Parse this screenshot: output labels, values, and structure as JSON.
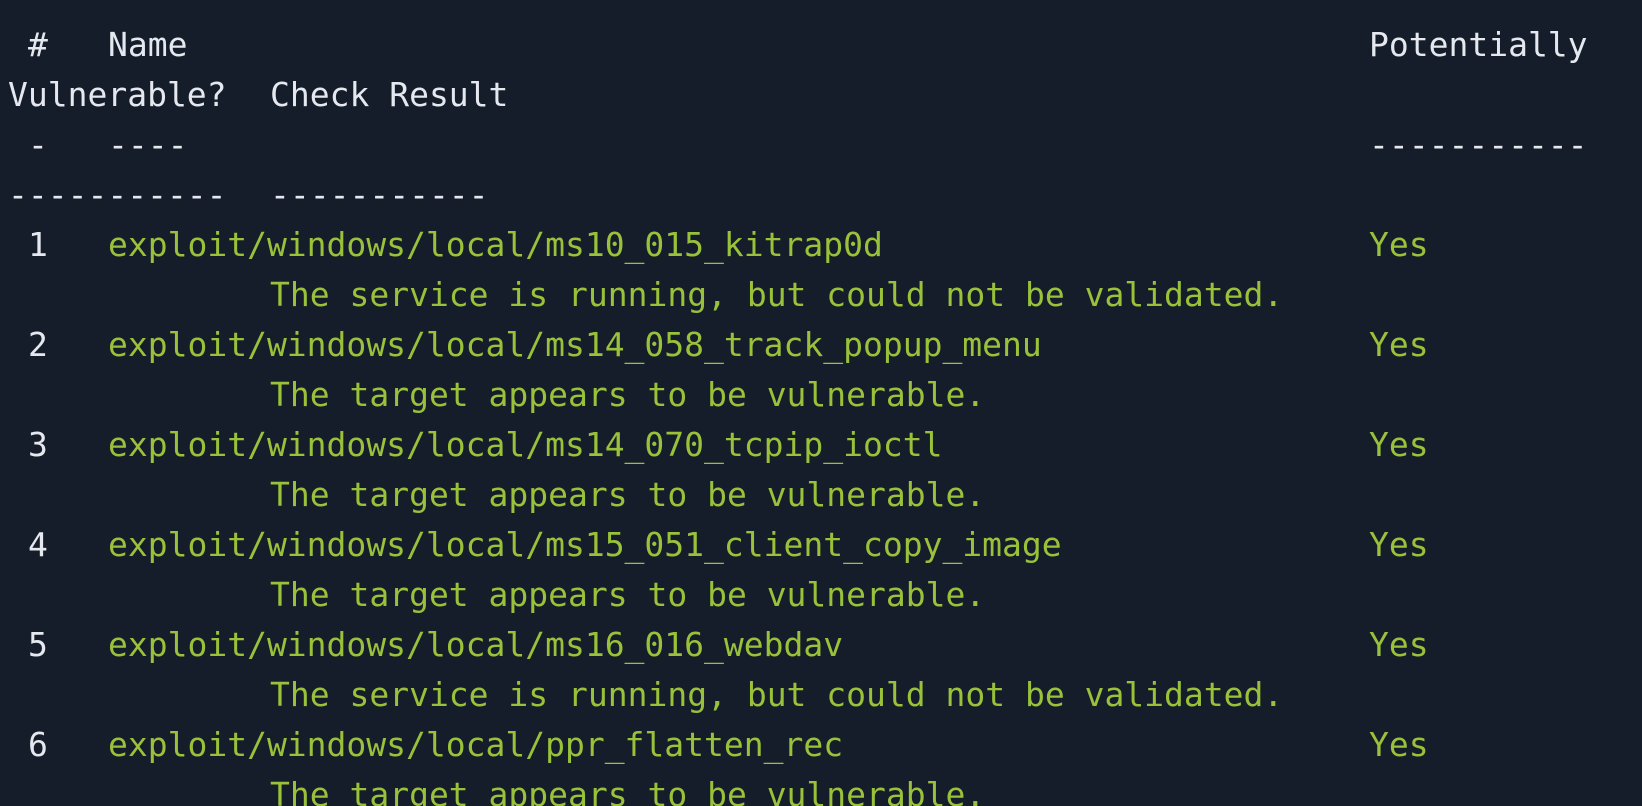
{
  "header": {
    "col_num": "#",
    "col_name": "Name",
    "col_potentially": "Potentially",
    "col_vulnerable": "Vulnerable?",
    "col_check": "Check Result"
  },
  "separator": {
    "num": "-",
    "name": "----",
    "potentially": "-----------",
    "vulnerable": "-----------",
    "check": "-----------"
  },
  "rows": [
    {
      "num": "1",
      "name": "exploit/windows/local/ms10_015_kitrap0d",
      "vulnerable": "Yes",
      "result": "The service is running, but could not be validated."
    },
    {
      "num": "2",
      "name": "exploit/windows/local/ms14_058_track_popup_menu",
      "vulnerable": "Yes",
      "result": "The target appears to be vulnerable."
    },
    {
      "num": "3",
      "name": "exploit/windows/local/ms14_070_tcpip_ioctl",
      "vulnerable": "Yes",
      "result": "The target appears to be vulnerable."
    },
    {
      "num": "4",
      "name": "exploit/windows/local/ms15_051_client_copy_image",
      "vulnerable": "Yes",
      "result": "The target appears to be vulnerable."
    },
    {
      "num": "5",
      "name": "exploit/windows/local/ms16_016_webdav",
      "vulnerable": "Yes",
      "result": "The service is running, but could not be validated."
    },
    {
      "num": "6",
      "name": "exploit/windows/local/ppr_flatten_rec",
      "vulnerable": "Yes",
      "result": "The target appears to be vulnerable."
    }
  ],
  "colors": {
    "background": "#161d2a",
    "text": "#e5e9ef",
    "highlight": "#99c23a"
  }
}
